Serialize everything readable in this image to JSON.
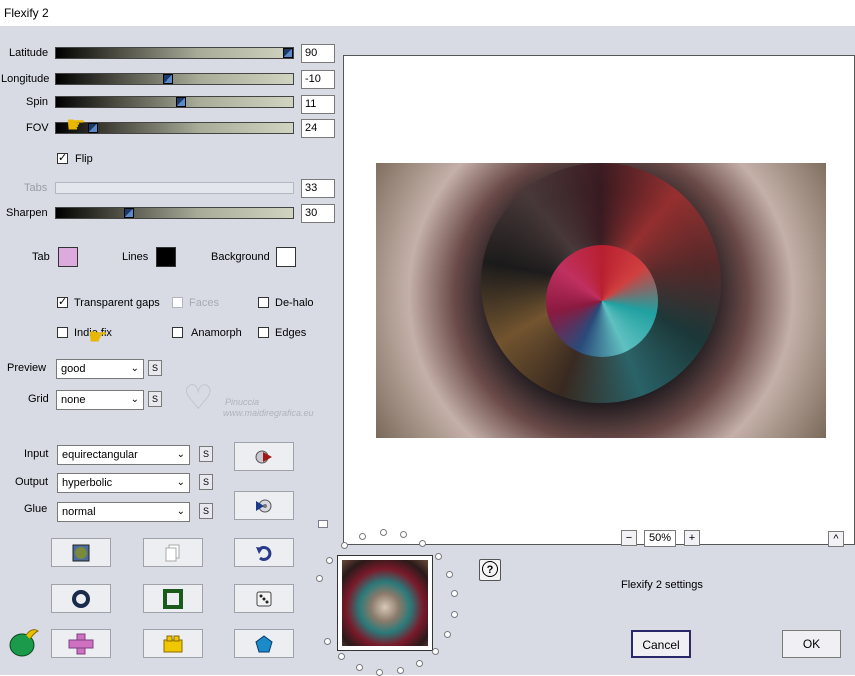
{
  "window": {
    "title": "Flexify 2"
  },
  "sliders": [
    {
      "label": "Latitude",
      "value": "90",
      "level": 1.0,
      "enabled": true
    },
    {
      "label": "Longitude",
      "value": "-10",
      "level": 0.47,
      "enabled": true
    },
    {
      "label": "Spin",
      "value": "11",
      "level": 0.53,
      "enabled": true
    },
    {
      "label": "FOV",
      "value": "24",
      "level": 0.14,
      "enabled": true
    },
    {
      "label": "Tabs",
      "value": "33",
      "level": 0.0,
      "enabled": false
    },
    {
      "label": "Sharpen",
      "value": "30",
      "level": 0.3,
      "enabled": true
    }
  ],
  "flip": {
    "label": "Flip",
    "checked": true
  },
  "colors": {
    "tab_label": "Tab",
    "tab": "#dcaadc",
    "lines_label": "Lines",
    "lines": "#000000",
    "background_label": "Background",
    "background": "#ffffff"
  },
  "options": {
    "transparent_gaps": {
      "label": "Transparent gaps",
      "checked": true
    },
    "faces": {
      "label": "Faces",
      "checked": false,
      "enabled": false
    },
    "de_halo": {
      "label": "De-halo",
      "checked": false
    },
    "indie_fix": {
      "label": "Indie fix",
      "checked": false
    },
    "anamorph": {
      "label": "Anamorph",
      "checked": false
    },
    "edges": {
      "label": "Edges",
      "checked": false
    }
  },
  "preview_select": {
    "label": "Preview",
    "value": "good"
  },
  "grid_select": {
    "label": "Grid",
    "value": "none"
  },
  "input_select": {
    "label": "Input",
    "value": "equirectangular"
  },
  "output_select": {
    "label": "Output",
    "value": "hyperbolic"
  },
  "glue_select": {
    "label": "Glue",
    "value": "normal"
  },
  "s_button_label": "S",
  "watermark": {
    "line1": "Pinuccia",
    "line2": "www.maidiregrafica.eu"
  },
  "zoom": {
    "value": "50%",
    "minus": "−",
    "plus": "+"
  },
  "expand_label": "^",
  "settings_name": "Flexify 2 settings",
  "buttons": {
    "cancel": "Cancel",
    "ok": "OK"
  },
  "info_label": "?"
}
